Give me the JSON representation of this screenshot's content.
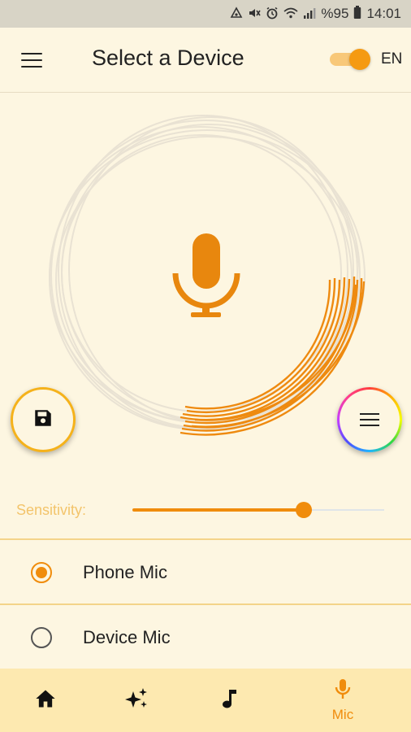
{
  "status_bar": {
    "battery_percent": "%95",
    "time": "14:01",
    "icons": [
      "sync-icon",
      "mute-icon",
      "alarm-icon",
      "wifi-icon",
      "signal-icon",
      "battery-icon"
    ]
  },
  "app_bar": {
    "title": "Select a Device",
    "language": "EN",
    "toggle_on": true
  },
  "sensitivity": {
    "label": "Sensitivity:",
    "value_fraction": 0.68
  },
  "device_options": [
    {
      "label": "Phone Mic",
      "selected": true
    },
    {
      "label": "Device Mic",
      "selected": false
    }
  ],
  "bottom_nav": {
    "items": [
      {
        "icon": "home-icon",
        "label": ""
      },
      {
        "icon": "sparkles-icon",
        "label": ""
      },
      {
        "icon": "music-note-icon",
        "label": ""
      },
      {
        "icon": "mic-icon",
        "label": "Mic",
        "active": true
      }
    ]
  },
  "colors": {
    "accent": "#f08c0c",
    "background": "#fdf6e1",
    "nav_background": "#fde9b0",
    "ring_faint": "#e9e2d3"
  }
}
